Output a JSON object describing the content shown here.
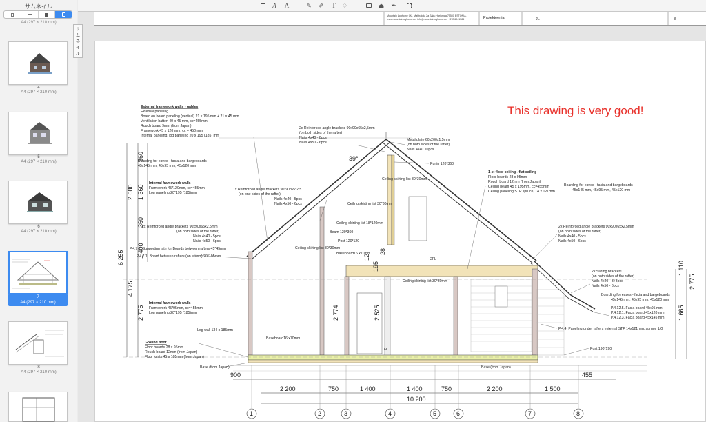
{
  "sidebar": {
    "title": "サムネイル",
    "tooltip": "サムネイル",
    "top_caption": "A4 (297 × 210 mm)",
    "pages": [
      {
        "num": "4",
        "size": "A4 (297 × 210 mm)"
      },
      {
        "num": "5",
        "size": "A4 (297 × 210 mm)"
      },
      {
        "num": "6",
        "size": "A4 (297 × 210 mm)"
      },
      {
        "num": "7",
        "size": "A4 (297 × 210 mm)",
        "selected": true
      },
      {
        "num": "8",
        "size": "A4 (297 × 210 mm)"
      }
    ]
  },
  "toolbar": {
    "icons": [
      "select-text-icon",
      "text-box-icon",
      "text-style-icon",
      "pen-icon",
      "highlighter-icon",
      "text-insert-icon",
      "shapes-icon",
      "comment-icon",
      "stamp-icon",
      "signature-icon",
      "crop-icon"
    ],
    "labels": {
      "text": "A",
      "text_style": "A",
      "textbox": "T"
    }
  },
  "title_block": {
    "company": "Mountain Loghome OÜ, Mahtratola 2a Saku Harjumaa 75501 ESTONIA,",
    "company_line2": "www.mountainloghome.ee, info@mountainloghome.ee, +372 6041584",
    "role": "Projekteerija",
    "initials": "JL",
    "sheet": "8"
  },
  "drawing": {
    "comment": "This drawing is very good!",
    "angle": "39°",
    "notes": {
      "ext_walls_title": "External framework walls - gables",
      "ext_walls": [
        "External paneling",
        "Board on board paneling (vertical) 21 x 195 mm + 21 x 45 mm",
        "Ventilation batten 40 x 45 mm, cc=455mm",
        "Rouch board 9mm (from Japan)",
        "Framework 45 x 120 mm, cc = 450 mm",
        "Internal paneling, log paneling 20 x 195 (185) mm"
      ],
      "eaves_left": [
        "Boarding for eaves - facia and bargeboards",
        "45x145 mm, 45x95 mm, 45x120 mm"
      ],
      "int_walls_title": "Internal framework walls",
      "int_walls": [
        "Framework 45*120mm, cc=455mm",
        "Log paneling 20*195 (185)mm"
      ],
      "angle_brackets_top": [
        "2x Reinforced angle brackets 90x90x65x2,5mm",
        "(on both sides of the rafter)",
        "Nails 4x40 - 8pcs",
        "Nails 4x50 - 6pcs"
      ],
      "metal_plate": [
        "Metal plate 60x200x1,5mm",
        "(on both sides of the rafter)",
        "Nails 4x40 10pcs"
      ],
      "purlin": "Purlin 120*360",
      "ceiling_top": "Ceiling skirting list 30*30mm",
      "first_floor_title": "1-st floor ceiling - flat ceiling",
      "first_floor": [
        "Floor boards 28 x 95mm",
        "Rouch board 12mm (from Japan)",
        "Ceiling beam 45 x 195mm, cc=455mm",
        "Ceiling paneling STP spruce, 14 x 121mm"
      ],
      "eaves_right_top": [
        "Boarding for eaves - facia and bargeboards",
        "45x145 mm, 45x95 mm, 45x120 mm"
      ],
      "one_bracket": [
        "1x Reinforced angle brackets 90*90*65*2,5",
        "(on one sides of the rafter)",
        "Nails 4x40 - 5pcs",
        "Nails 4x50 - 6pcs"
      ],
      "ceiling_mid": "Ceiling skirting list 30*30mm",
      "ceiling_18": "Ceiling skirting list 18*120mm",
      "beam": "Beam 120*360",
      "post": "Post 120*120",
      "ceiling_left": "Ceiling skirting list 30*30mm",
      "baseboard_upper": "Baseboard16 x70mm",
      "brackets_left": [
        "2x Reinforced angle brackets 90x90x65x2,5mm",
        "(on both sides of the rafter)",
        "Nails 4x40 - 5pcs",
        "Nails 4x50 - 6pcs"
      ],
      "p472": "P.4.7.2. Supporting lath for Boards between rafters 45*45mm",
      "p471": "P.4.7.1. Board between rafters (on eaves) 20*195mm",
      "brackets_right": [
        "2x Reinforced angle brackets 90x90x65x2,5mm",
        "(on both sides of the rafter)",
        "Nails 4x40 - 5pcs",
        "Nails 4x50 - 6pcs"
      ],
      "fl2": "2FL",
      "ceiling_bottom": "Ceiling skirting list 30*30mm",
      "sliding": [
        "2x Sliding brackets",
        "(on both sides of the rafter)",
        "Nails 4x40 - 3+3pcs",
        "Nails 4x50 - 6pcs"
      ],
      "eaves_right_low": [
        "Boarding for eaves - facia and bargeboards",
        "45x145 mm, 45x95 mm, 45x120 mm"
      ],
      "facias": [
        "P.4.12.5. Facia board 45x95 mm",
        "P.4.12.1. Facia board 45x120 mm",
        "P.4.12.3. Facia board 45x145 mm"
      ],
      "p444": "P.4.4. Paneling under rafters external STP 14x121mm, spruce 1/G",
      "int_walls2_title": "Internal framework walls",
      "int_walls2": [
        "Framework 45*95mm, cc=455mm",
        "Log paneling 20*195 (185)mm"
      ],
      "log_wall": "Log wall 134 x 185mm",
      "baseboard_lower": "Baseboard16 x70mm",
      "fl1": "1FL",
      "post_right": "Post 190*190",
      "ground_title": "Ground floor",
      "ground": [
        "Floor boards 28 x 95mm",
        "Rouch board 12mm (from Japan)",
        "Floor joists 45 x 105mm (from Japan)"
      ],
      "base_left": "Base (from Japan)",
      "base_right": "Base (from Japan)"
    },
    "vertical_dims_left": [
      "360",
      "1 360",
      "2 080",
      "360",
      "1 400",
      "6 255",
      "4 175",
      "2 775"
    ],
    "vertical_dims_mid": [
      "2 774",
      "2 525",
      "28",
      "195",
      "12"
    ],
    "vertical_dims_right": [
      "1 110",
      "2 775",
      "1 665"
    ],
    "bottom_dims": [
      "900",
      "2 200",
      "750",
      "1 400",
      "1 400",
      "750",
      "2 200",
      "1 500",
      "455"
    ],
    "total_dim": "10 200",
    "grid_axes": [
      "1",
      "2",
      "3",
      "4",
      "5",
      "6",
      "7",
      "8"
    ]
  },
  "colors": {
    "accent": "#3d8bf0",
    "comment": "#e8302a",
    "wood": "#f2e3b8",
    "floor": "#e9f0a6",
    "wall": "#d8c8c4"
  }
}
